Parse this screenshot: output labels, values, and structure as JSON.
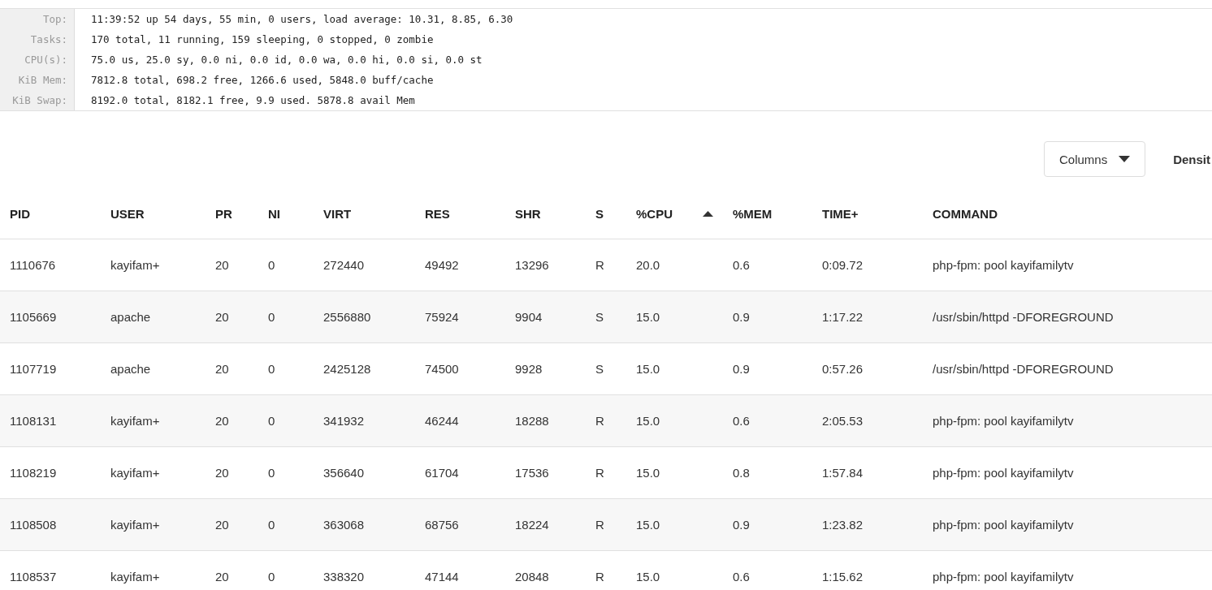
{
  "summary": [
    {
      "label": "Top:",
      "value": "11:39:52 up 54 days, 55 min, 0 users, load average: 10.31, 8.85, 6.30"
    },
    {
      "label": "Tasks:",
      "value": "170 total, 11 running, 159 sleeping, 0 stopped, 0 zombie"
    },
    {
      "label": "CPU(s):",
      "value": "75.0 us, 25.0 sy, 0.0 ni, 0.0 id, 0.0 wa, 0.0 hi, 0.0 si, 0.0 st"
    },
    {
      "label": "KiB Mem:",
      "value": "7812.8 total, 698.2 free, 1266.6 used, 5848.0 buff/cache"
    },
    {
      "label": "KiB Swap:",
      "value": "8192.0 total, 8182.1 free, 9.9 used. 5878.8 avail Mem"
    }
  ],
  "toolbar": {
    "columns_button": "Columns",
    "density_button": "Densit"
  },
  "table": {
    "columns": [
      {
        "label": "PID",
        "sorted": false
      },
      {
        "label": "USER",
        "sorted": false
      },
      {
        "label": "PR",
        "sorted": false
      },
      {
        "label": "NI",
        "sorted": false
      },
      {
        "label": "VIRT",
        "sorted": false
      },
      {
        "label": "RES",
        "sorted": false
      },
      {
        "label": "SHR",
        "sorted": false
      },
      {
        "label": "S",
        "sorted": false
      },
      {
        "label": "%CPU",
        "sorted": true
      },
      {
        "label": "%MEM",
        "sorted": false
      },
      {
        "label": "TIME+",
        "sorted": false
      },
      {
        "label": "COMMAND",
        "sorted": false
      }
    ],
    "rows": [
      [
        "1110676",
        "kayifam+",
        "20",
        "0",
        "272440",
        "49492",
        "13296",
        "R",
        "20.0",
        "0.6",
        "0:09.72",
        "php-fpm: pool kayifamilytv"
      ],
      [
        "1105669",
        "apache",
        "20",
        "0",
        "2556880",
        "75924",
        "9904",
        "S",
        "15.0",
        "0.9",
        "1:17.22",
        "/usr/sbin/httpd -DFOREGROUND"
      ],
      [
        "1107719",
        "apache",
        "20",
        "0",
        "2425128",
        "74500",
        "9928",
        "S",
        "15.0",
        "0.9",
        "0:57.26",
        "/usr/sbin/httpd -DFOREGROUND"
      ],
      [
        "1108131",
        "kayifam+",
        "20",
        "0",
        "341932",
        "46244",
        "18288",
        "R",
        "15.0",
        "0.6",
        "2:05.53",
        "php-fpm: pool kayifamilytv"
      ],
      [
        "1108219",
        "kayifam+",
        "20",
        "0",
        "356640",
        "61704",
        "17536",
        "R",
        "15.0",
        "0.8",
        "1:57.84",
        "php-fpm: pool kayifamilytv"
      ],
      [
        "1108508",
        "kayifam+",
        "20",
        "0",
        "363068",
        "68756",
        "18224",
        "R",
        "15.0",
        "0.9",
        "1:23.82",
        "php-fpm: pool kayifamilytv"
      ],
      [
        "1108537",
        "kayifam+",
        "20",
        "0",
        "338320",
        "47144",
        "20848",
        "R",
        "15.0",
        "0.6",
        "1:15.62",
        "php-fpm: pool kayifamilytv"
      ]
    ]
  }
}
